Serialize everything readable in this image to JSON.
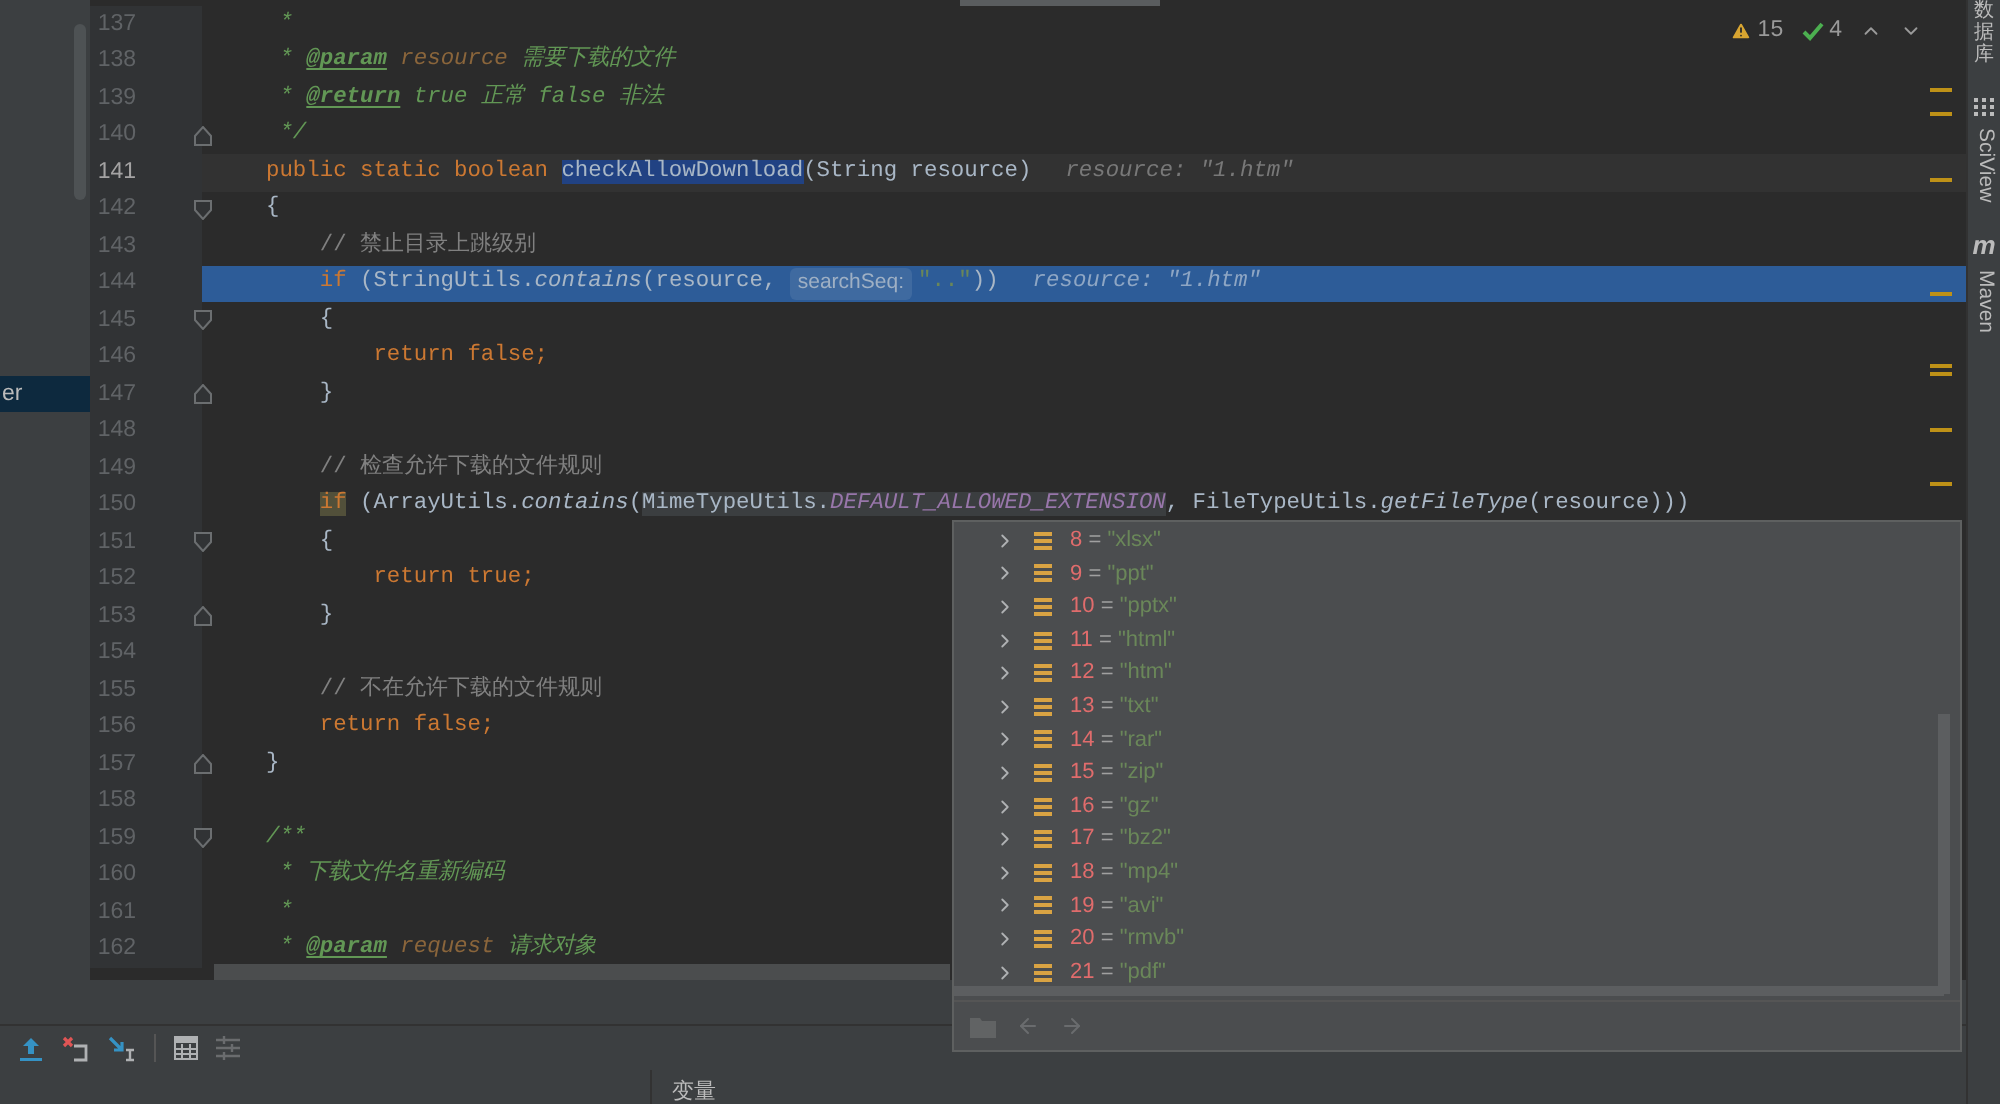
{
  "sidebar": {
    "items": [
      {
        "text": "er",
        "selected": true
      }
    ]
  },
  "inspections": {
    "warnings": "15",
    "weak_warnings": "4"
  },
  "editor": {
    "lines": [
      {
        "number": "137",
        "current": false,
        "selected": false,
        "segments": [
          {
            "kind": "code",
            "tokens": [
              {
                "kind": "doc",
                "text": " *"
              }
            ]
          }
        ]
      },
      {
        "number": "138",
        "current": false,
        "selected": false,
        "segments": [
          {
            "kind": "code",
            "tokens": [
              {
                "kind": "doc",
                "text": " * "
              },
              {
                "kind": "doctag",
                "text": "@param"
              },
              {
                "kind": "docparam",
                "text": " resource"
              },
              {
                "kind": "doc",
                "text": " 需要下载的文件"
              }
            ]
          }
        ]
      },
      {
        "number": "139",
        "current": false,
        "selected": false,
        "segments": [
          {
            "kind": "code",
            "tokens": [
              {
                "kind": "doc",
                "text": " * "
              },
              {
                "kind": "doctag",
                "text": "@return"
              },
              {
                "kind": "doc",
                "text": " true 正常 false 非法"
              }
            ]
          }
        ]
      },
      {
        "number": "140",
        "current": false,
        "selected": false,
        "fold": {
          "kind": "close"
        },
        "segments": [
          {
            "kind": "code",
            "tokens": [
              {
                "kind": "doc",
                "text": " */"
              }
            ]
          }
        ]
      },
      {
        "number": "141",
        "current": true,
        "selected": false,
        "segments": [
          {
            "kind": "code",
            "tokens": [
              {
                "kind": "kw",
                "text": "public static boolean "
              },
              {
                "kind": "plain",
                "text": "checkAllowDownload",
                "highlight": {
                  "kind": "definition"
                }
              },
              {
                "kind": "plain",
                "text": "(String resource)"
              }
            ]
          },
          {
            "kind": "inline_value",
            "text": "resource: \"1.htm\""
          }
        ]
      },
      {
        "number": "142",
        "current": false,
        "selected": false,
        "fold": {
          "kind": "open"
        },
        "segments": [
          {
            "kind": "code",
            "tokens": [
              {
                "kind": "plain",
                "text": "{"
              }
            ]
          }
        ]
      },
      {
        "number": "143",
        "current": false,
        "selected": false,
        "segments": [
          {
            "kind": "code",
            "tokens": [
              {
                "kind": "comment",
                "text": "    // 禁止目录上跳级别"
              }
            ]
          }
        ]
      },
      {
        "number": "144",
        "current": false,
        "selected": true,
        "segments": [
          {
            "kind": "code",
            "tokens": [
              {
                "kind": "kw",
                "text": "    if "
              },
              {
                "kind": "plain",
                "text": "(StringUtils."
              },
              {
                "kind": "method",
                "text": "contains"
              },
              {
                "kind": "plain",
                "text": "(resource, "
              }
            ]
          },
          {
            "kind": "param_hint",
            "text": "searchSeq:"
          },
          {
            "kind": "code",
            "tokens": [
              {
                "kind": "str",
                "text": "\"..\""
              },
              {
                "kind": "plain",
                "text": "))"
              }
            ]
          },
          {
            "kind": "inline_value",
            "text": "resource: \"1.htm\""
          }
        ]
      },
      {
        "number": "145",
        "current": false,
        "selected": false,
        "fold": {
          "kind": "open"
        },
        "segments": [
          {
            "kind": "code",
            "tokens": [
              {
                "kind": "plain",
                "text": "    {"
              }
            ]
          }
        ]
      },
      {
        "number": "146",
        "current": false,
        "selected": false,
        "segments": [
          {
            "kind": "code",
            "tokens": [
              {
                "kind": "kw",
                "text": "        return false;"
              }
            ]
          }
        ]
      },
      {
        "number": "147",
        "current": false,
        "selected": false,
        "fold": {
          "kind": "close"
        },
        "segments": [
          {
            "kind": "code",
            "tokens": [
              {
                "kind": "plain",
                "text": "    }"
              }
            ]
          }
        ]
      },
      {
        "number": "148",
        "current": false,
        "selected": false
      },
      {
        "number": "149",
        "current": false,
        "selected": false,
        "segments": [
          {
            "kind": "code",
            "tokens": [
              {
                "kind": "comment",
                "text": "    // 检查允许下载的文件规则"
              }
            ]
          }
        ]
      },
      {
        "number": "150",
        "current": false,
        "selected": false,
        "segments": [
          {
            "kind": "code",
            "tokens": [
              {
                "kind": "kw",
                "text": "    if",
                "highlight": {
                  "kind": "usage"
                }
              },
              {
                "kind": "plain",
                "text": " (ArrayUtils."
              },
              {
                "kind": "method",
                "text": "contains"
              },
              {
                "kind": "plain",
                "text": "("
              },
              {
                "kind": "plain",
                "text": "MimeTypeUtils.",
                "highlight": {
                  "kind": "box"
                }
              },
              {
                "kind": "const",
                "text": "DEFAULT_ALLOWED_EXTENSION",
                "highlight": {
                  "kind": "box"
                }
              },
              {
                "kind": "plain",
                "text": ", FileTypeUtils."
              },
              {
                "kind": "method",
                "text": "getFileType"
              },
              {
                "kind": "plain",
                "text": "(resource)))"
              }
            ]
          }
        ]
      },
      {
        "number": "151",
        "current": false,
        "selected": false,
        "fold": {
          "kind": "open"
        },
        "segments": [
          {
            "kind": "code",
            "tokens": [
              {
                "kind": "plain",
                "text": "    {"
              }
            ]
          }
        ]
      },
      {
        "number": "152",
        "current": false,
        "selected": false,
        "segments": [
          {
            "kind": "code",
            "tokens": [
              {
                "kind": "kw",
                "text": "        return true;"
              }
            ]
          }
        ]
      },
      {
        "number": "153",
        "current": false,
        "selected": false,
        "fold": {
          "kind": "close"
        },
        "segments": [
          {
            "kind": "code",
            "tokens": [
              {
                "kind": "plain",
                "text": "    }"
              }
            ]
          }
        ]
      },
      {
        "number": "154",
        "current": false,
        "selected": false
      },
      {
        "number": "155",
        "current": false,
        "selected": false,
        "segments": [
          {
            "kind": "code",
            "tokens": [
              {
                "kind": "comment",
                "text": "    // 不在允许下载的文件规则"
              }
            ]
          }
        ]
      },
      {
        "number": "156",
        "current": false,
        "selected": false,
        "segments": [
          {
            "kind": "code",
            "tokens": [
              {
                "kind": "kw",
                "text": "    return false;"
              }
            ]
          }
        ]
      },
      {
        "number": "157",
        "current": false,
        "selected": false,
        "fold": {
          "kind": "close"
        },
        "segments": [
          {
            "kind": "code",
            "tokens": [
              {
                "kind": "plain",
                "text": "}"
              }
            ]
          }
        ]
      },
      {
        "number": "158",
        "current": false,
        "selected": false
      },
      {
        "number": "159",
        "current": false,
        "selected": false,
        "fold": {
          "kind": "open"
        },
        "segments": [
          {
            "kind": "code",
            "tokens": [
              {
                "kind": "doc",
                "text": "/**"
              }
            ]
          }
        ]
      },
      {
        "number": "160",
        "current": false,
        "selected": false,
        "segments": [
          {
            "kind": "code",
            "tokens": [
              {
                "kind": "doc",
                "text": " * 下载文件名重新编码"
              }
            ]
          }
        ]
      },
      {
        "number": "161",
        "current": false,
        "selected": false,
        "segments": [
          {
            "kind": "code",
            "tokens": [
              {
                "kind": "doc",
                "text": " *"
              }
            ]
          }
        ]
      },
      {
        "number": "162",
        "current": false,
        "selected": false,
        "segments": [
          {
            "kind": "code",
            "tokens": [
              {
                "kind": "doc",
                "text": " * "
              },
              {
                "kind": "doctag",
                "text": "@param"
              },
              {
                "kind": "docparam",
                "text": " request"
              },
              {
                "kind": "doc",
                "text": " 请求对象"
              }
            ]
          }
        ]
      }
    ]
  },
  "popup": {
    "rows": [
      {
        "index": "8",
        "eq": "=",
        "value": "\"xlsx\"",
        "expanded": false
      },
      {
        "index": "9",
        "eq": "=",
        "value": "\"ppt\"",
        "expanded": false
      },
      {
        "index": "10",
        "eq": "=",
        "value": "\"pptx\"",
        "expanded": false
      },
      {
        "index": "11",
        "eq": "=",
        "value": "\"html\"",
        "expanded": false
      },
      {
        "index": "12",
        "eq": "=",
        "value": "\"htm\"",
        "expanded": false
      },
      {
        "index": "13",
        "eq": "=",
        "value": "\"txt\"",
        "expanded": false
      },
      {
        "index": "14",
        "eq": "=",
        "value": "\"rar\"",
        "expanded": false
      },
      {
        "index": "15",
        "eq": "=",
        "value": "\"zip\"",
        "expanded": false
      },
      {
        "index": "16",
        "eq": "=",
        "value": "\"gz\"",
        "expanded": false
      },
      {
        "index": "17",
        "eq": "=",
        "value": "\"bz2\"",
        "expanded": false
      },
      {
        "index": "18",
        "eq": "=",
        "value": "\"mp4\"",
        "expanded": false
      },
      {
        "index": "19",
        "eq": "=",
        "value": "\"avi\"",
        "expanded": false
      },
      {
        "index": "20",
        "eq": "=",
        "value": "\"rmvb\"",
        "expanded": false
      },
      {
        "index": "21",
        "eq": "=",
        "value": "\"pdf\"",
        "expanded": false
      }
    ]
  },
  "tool_strip": [
    {
      "kind": "cjk",
      "label": "数据库"
    },
    {
      "kind": "grid",
      "label": "SciView"
    },
    {
      "kind": "glyph",
      "glyph": "m",
      "label": "Maven"
    }
  ],
  "bottom_tabs": [
    {
      "label": "变量"
    }
  ]
}
